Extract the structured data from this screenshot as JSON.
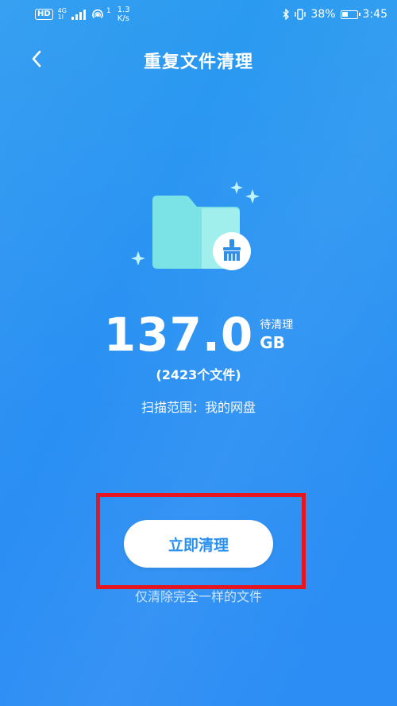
{
  "status_bar": {
    "hd": "HD",
    "network_type": "4G",
    "network_sub": "1l",
    "wifi_sup": "1",
    "speed_value": "1.3",
    "speed_unit": "K/s",
    "battery_percent": "38%",
    "time": "3:45"
  },
  "header": {
    "title": "重复文件清理",
    "back_icon": "chevron-left-icon"
  },
  "summary": {
    "size_value": "137.0",
    "pending_label": "待清理",
    "unit": "GB",
    "file_count": "(2423个文件)",
    "scan_range": "扫描范围：我的网盘"
  },
  "actions": {
    "clean_button_label": "立即清理"
  },
  "footer": {
    "note": "仅清除完全一样的文件"
  },
  "colors": {
    "background": "#2a95f2",
    "button_text": "#2a90f0",
    "highlight": "#e5161f",
    "folder_back": "#7ee8e8",
    "folder_front": "#a8f4ee",
    "badge_fill": "#ffffff",
    "brush": "#2f8ee6"
  }
}
